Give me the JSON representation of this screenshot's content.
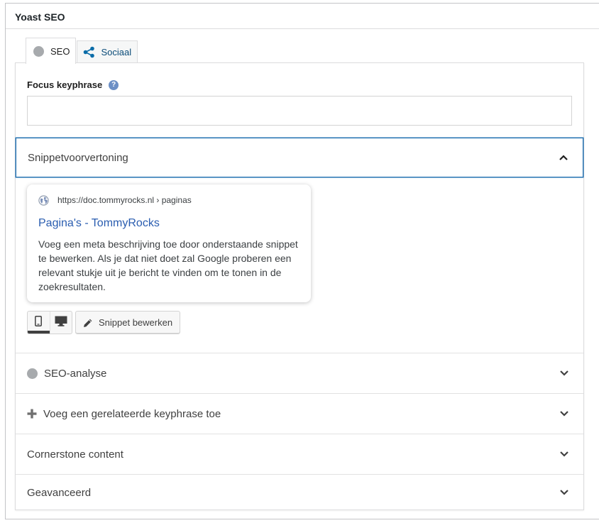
{
  "metabox": {
    "title": "Yoast SEO"
  },
  "tabs": [
    {
      "label": "SEO",
      "icon": "status-dot-gray"
    },
    {
      "label": "Sociaal",
      "icon": "share-icon"
    }
  ],
  "focus": {
    "label": "Focus keyphrase",
    "help": "?",
    "value": "",
    "placeholder": ""
  },
  "snippet_section": {
    "label": "Snippetvoorvertoning",
    "expanded": true
  },
  "snippet": {
    "url": "https://doc.tommyrocks.nl › paginas",
    "title": "Pagina's - TommyRocks",
    "description": "Voeg een meta beschrijving toe door onderstaande snippet te bewerken. Als je dat niet doet zal Google proberen een relevant stukje uit je bericht te vinden om te tonen in de zoekresultaten."
  },
  "preview_modes": {
    "active": "mobile",
    "options": [
      "mobile",
      "desktop"
    ]
  },
  "edit_snippet_label": "Snippet bewerken",
  "sections": [
    {
      "label": "SEO-analyse",
      "icon": "status-dot-gray"
    },
    {
      "label": "Voeg een gerelateerde keyphrase toe",
      "icon": "plus-icon"
    },
    {
      "label": "Cornerstone content",
      "icon": ""
    },
    {
      "label": "Geavanceerd",
      "icon": ""
    }
  ],
  "colors": {
    "accent": "#2271b1",
    "link": "#2a5db0",
    "status_gray": "#a7aaad",
    "help_blue": "#6c8fc5"
  }
}
